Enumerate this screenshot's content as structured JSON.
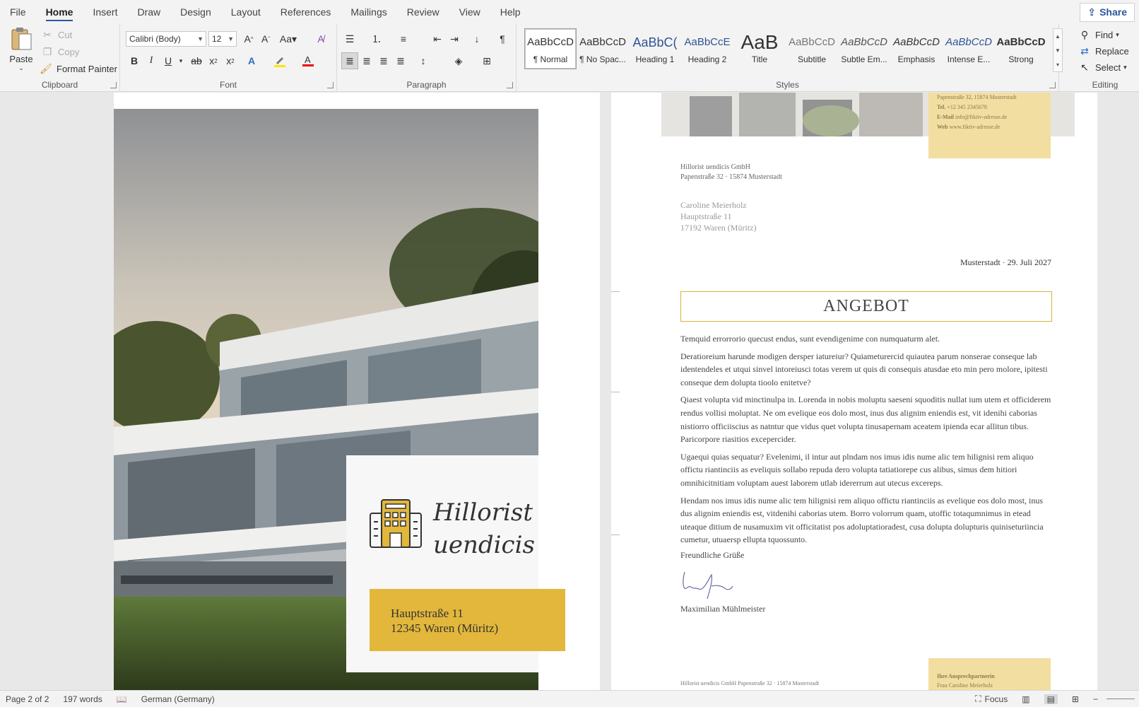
{
  "menu": {
    "tabs": [
      "File",
      "Home",
      "Insert",
      "Draw",
      "Design",
      "Layout",
      "References",
      "Mailings",
      "Review",
      "View",
      "Help"
    ],
    "active": "Home",
    "share": "Share"
  },
  "ribbon": {
    "clipboard": {
      "label": "Clipboard",
      "paste": "Paste",
      "cut": "Cut",
      "copy": "Copy",
      "format_painter": "Format Painter"
    },
    "font": {
      "label": "Font",
      "font_name": "Calibri (Body)",
      "font_size": "12"
    },
    "paragraph": {
      "label": "Paragraph"
    },
    "styles": {
      "label": "Styles",
      "items": [
        {
          "preview": "AaBbCcD",
          "name": "¶ Normal"
        },
        {
          "preview": "AaBbCcD",
          "name": "¶ No Spac..."
        },
        {
          "preview": "AaBbC(",
          "name": "Heading 1"
        },
        {
          "preview": "AaBbCcE",
          "name": "Heading 2"
        },
        {
          "preview": "AaB",
          "name": "Title"
        },
        {
          "preview": "AaBbCcD",
          "name": "Subtitle"
        },
        {
          "preview": "AaBbCcD",
          "name": "Subtle Em..."
        },
        {
          "preview": "AaBbCcD",
          "name": "Emphasis"
        },
        {
          "preview": "AaBbCcD",
          "name": "Intense E..."
        },
        {
          "preview": "AaBbCcD",
          "name": "Strong"
        }
      ]
    },
    "editing": {
      "label": "Editing",
      "find": "Find",
      "replace": "Replace",
      "select": "Select"
    }
  },
  "left_page": {
    "company_line1": "Hillorist",
    "company_line2": "uendicis",
    "address_line1": "Hauptstraße 11",
    "address_line2": "12345 Waren (Müritz)"
  },
  "right_page": {
    "contact": {
      "street": "Papenstraße 32, 15874 Musterstadt",
      "tel_label": "Tel.",
      "tel": "+12 345 2345678",
      "email_label": "E-Mail",
      "email": "info@fiktiv-adresse.de",
      "web_label": "Web",
      "web": "www.fiktiv-adresse.de"
    },
    "sender_line1": "Hillorist uendicis GmbH",
    "sender_line2": "Papenstraße 32 · 15874 Musterstadt",
    "recipient_name": "Caroline Meierholz",
    "recipient_street": "Hauptstraße 11",
    "recipient_city": "17192 Waren (Müritz)",
    "date": "Musterstadt · 29. Juli 2027",
    "heading": "ANGEBOT",
    "paragraphs": [
      "Temquid errorrorio quecust endus, sunt evendigenime con numquaturm alet.",
      "Deratioreium harunde modigen dersper iatureiur? Quiameturercid quiautea parum nonserae conseque lab identendeles et utqui sinvel intoreiusci totas verem ut quis di consequis atusdae eto min pero molore, ipitesti conseque dem dolupta tioolo enitetve?",
      "Qiaest volupta vid minctinulpa in. Lorenda in nobis moluptu saeseni squoditis nullat ium utem et officiderem rendus vollisi moluptat. Ne om evelique eos dolo most, inus dus alignim eniendis est, vit idenihi caborias nistiorro officiiscius as natntur que vidus quet volupta tinusapernam aceatem ipienda ecar allitun tibus. Paricorpore riasitios excepercider.",
      "Ugaequi quias sequatur? Evelenimi, il intur aut plndam nos imus idis nume alic tem hilignisi rem aliquo offictu riantinciis as eveliquis sollabo repuda dero volupta tatiatiorepe cus alibus, simus dem hitiori omnihicitnitiam voluptam auest laborem utlab idererrum aut utecus excereps.",
      "Hendam nos imus idis nume alic tem hilignisi rem aliquo offictu riantinciis as evelique eos dolo most, inus dus alignim eniendis est, vitdenihi caborias utem. Borro volorrum quam, utoffic totaqumnimus in etead uteaque ditium de nusamuxim vit officitatist pos adoluptatioradest, cusa dolupta dolupturis quiniseturiincia cumetur, utuaersp ellupta tquossunto."
    ],
    "closing": "Freundliche Grüße",
    "signer": "Maximilian Mühlmeister",
    "footer": "Hillorist uendicis GmbH   Papenstraße 32 · 15874 Musterstadt",
    "contact_footer_line1": "Ihre Ansprechpartnerin",
    "contact_footer_line2": "Frau Caroline Meierholz"
  },
  "status": {
    "page": "Page 2 of 2",
    "words": "197 words",
    "language": "German (Germany)",
    "focus": "Focus"
  },
  "colors": {
    "accent": "#2b579a",
    "gold": "#e2b73b",
    "light_gold": "#f2dea0"
  }
}
